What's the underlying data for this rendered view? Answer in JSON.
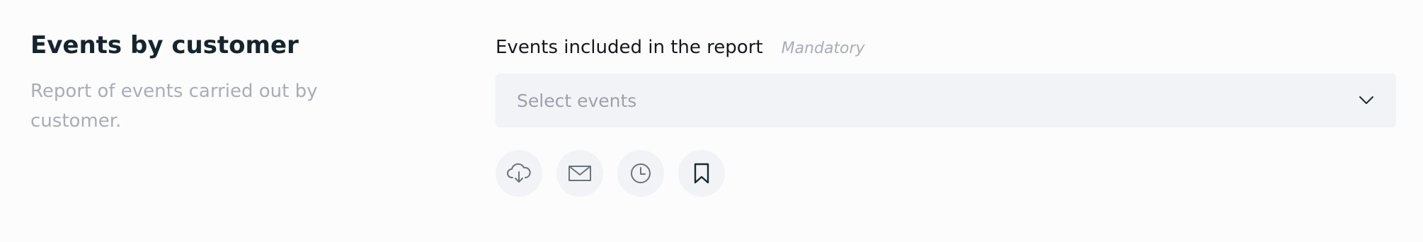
{
  "report": {
    "title": "Events by customer",
    "description": "Report of events carried out by customer."
  },
  "events_field": {
    "label": "Events included in the report",
    "required_note": "Mandatory",
    "placeholder": "Select events",
    "dropdown_icon": "chevron-down-icon"
  },
  "actions": [
    {
      "icon": "cloud-download-icon"
    },
    {
      "icon": "mail-icon"
    },
    {
      "icon": "clock-icon"
    },
    {
      "icon": "bookmark-icon"
    }
  ],
  "colors": {
    "background": "#fcfcfd",
    "title": "#14252e",
    "muted_text": "#a9adb9",
    "input_background": "#f2f3f7",
    "icon_gray": "#6b747c",
    "icon_dark": "#1a2a33"
  }
}
